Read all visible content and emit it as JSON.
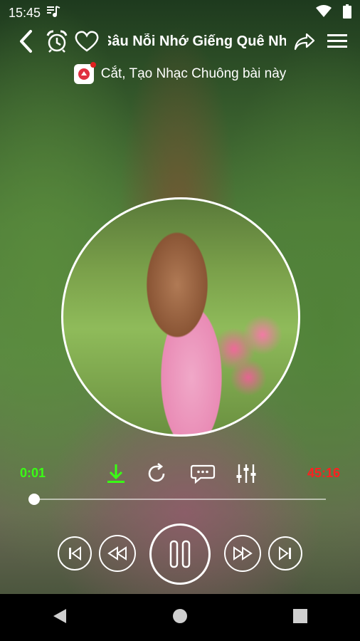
{
  "status_bar": {
    "time": "15:45"
  },
  "header": {
    "title": "Sâu Nỗi Nhớ Giếng Quê Nhà"
  },
  "ringtone": {
    "label": "Cắt, Tạo Nhạc Chuông bài này"
  },
  "player": {
    "current_time": "0:01",
    "duration": "45:16",
    "progress": 0.0
  },
  "colors": {
    "current_time": "#39ff14",
    "duration": "#ff2020",
    "download_icon": "#39ff14"
  },
  "icons": [
    "back-icon",
    "alarm-icon",
    "heart-icon",
    "share-icon",
    "menu-icon",
    "ringtone-icon",
    "download-icon",
    "repeat-icon",
    "comment-icon",
    "equalizer-icon",
    "previous-icon",
    "rewind-icon",
    "pause-icon",
    "fast-forward-icon",
    "next-icon",
    "nav-back-icon",
    "nav-home-icon",
    "nav-recents-icon"
  ]
}
